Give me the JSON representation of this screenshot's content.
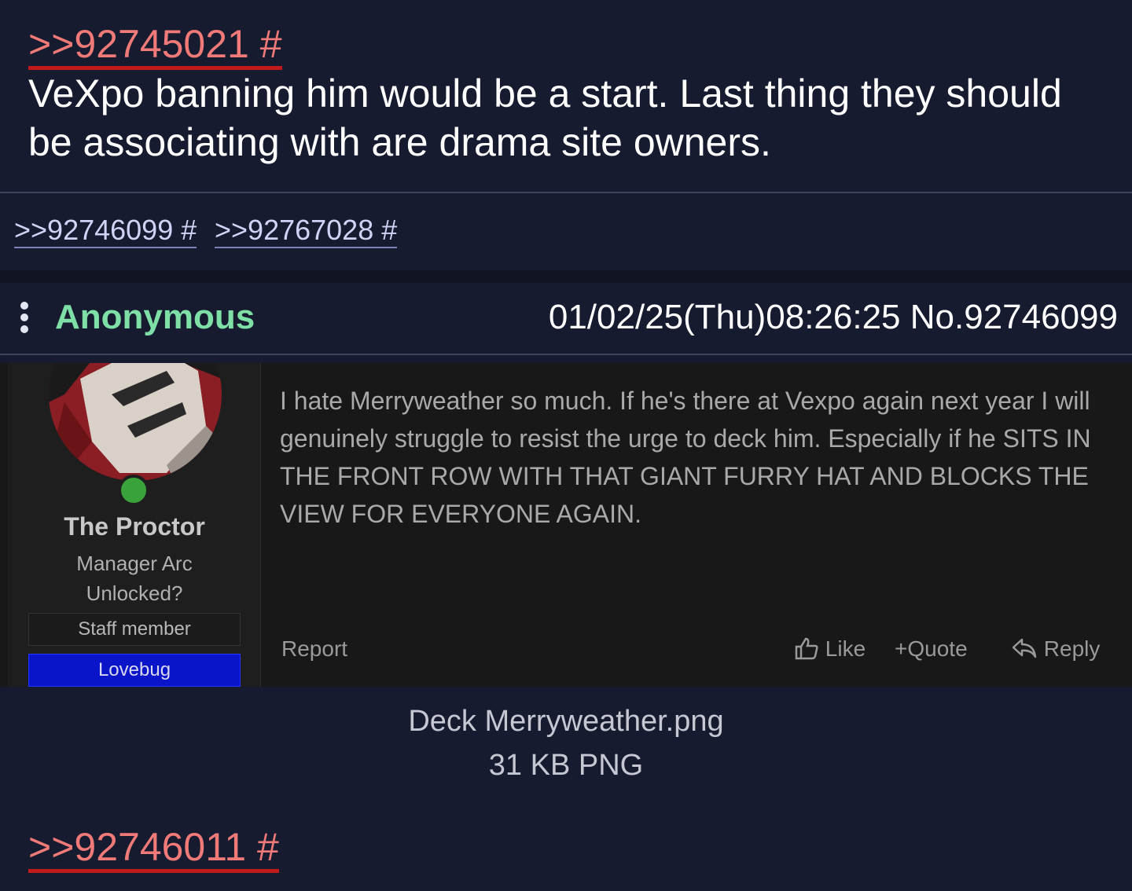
{
  "top_post": {
    "quote_link": ">>92745021 #",
    "comment": "VeXpo banning him would be a start. Last thing they should be associating with are drama site owners."
  },
  "backlinks": [
    ">>92746099 #",
    ">>92767028 #"
  ],
  "reply_post": {
    "name": "Anonymous",
    "meta": "01/02/25(Thu)08:26:25 No.92746099",
    "menu_icon": "kebab-menu-icon",
    "image": {
      "forum_user": {
        "username": "The Proctor",
        "title_line1": "Manager Arc",
        "title_line2": "Unlocked?",
        "badge_staff": "Staff member",
        "badge_group": "Lovebug"
      },
      "forum_text": "I hate Merryweather so much. If he's there at Vexpo again next year I will genuinely struggle to resist the urge to deck him. Especially if he SITS IN THE FRONT ROW WITH THAT GIANT FURRY HAT AND BLOCKS THE VIEW FOR EVERYONE AGAIN.",
      "actions": {
        "report": "Report",
        "like": "Like",
        "quote": "Quote",
        "reply": "Reply"
      }
    },
    "file_name": "Deck Merryweather.png",
    "file_meta": "31 KB PNG",
    "quote_link": ">>92746011 #"
  },
  "colors": {
    "background": "#161b2f",
    "quote_link": "#f07a78",
    "name": "#7ee0a6",
    "lovebug_badge": "#0a14c8"
  }
}
